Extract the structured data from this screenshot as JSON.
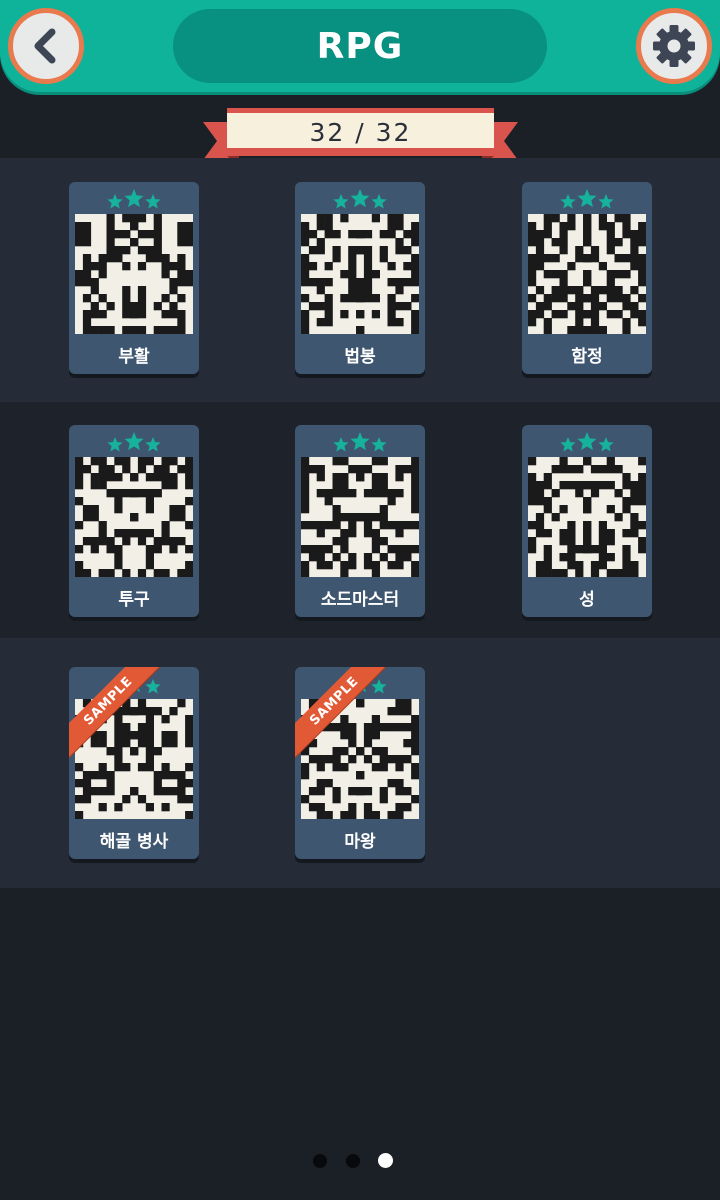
{
  "header": {
    "title": "RPG",
    "back_icon": "chevron-left-icon",
    "settings_icon": "gear-icon"
  },
  "progress": {
    "text": "32 / 32"
  },
  "colors": {
    "accent": "#0fb39a",
    "accent_dark": "#089080",
    "button_ring": "#e87a4d",
    "card": "#3f5670",
    "star": "#16b29c",
    "sample": "#e25a35"
  },
  "puzzles": [
    {
      "name": "부활",
      "stars": 3,
      "sample": false
    },
    {
      "name": "법봉",
      "stars": 3,
      "sample": false
    },
    {
      "name": "함정",
      "stars": 3,
      "sample": false
    },
    {
      "name": "투구",
      "stars": 3,
      "sample": false
    },
    {
      "name": "소드마스터",
      "stars": 3,
      "sample": false
    },
    {
      "name": "성",
      "stars": 3,
      "sample": false
    },
    {
      "name": "해골 병사",
      "stars": 3,
      "sample": true,
      "sample_label": "SAMPLE"
    },
    {
      "name": "마왕",
      "stars": 3,
      "sample": true,
      "sample_label": "SAMPLE"
    }
  ],
  "pagination": {
    "pages": 3,
    "current": 3
  }
}
